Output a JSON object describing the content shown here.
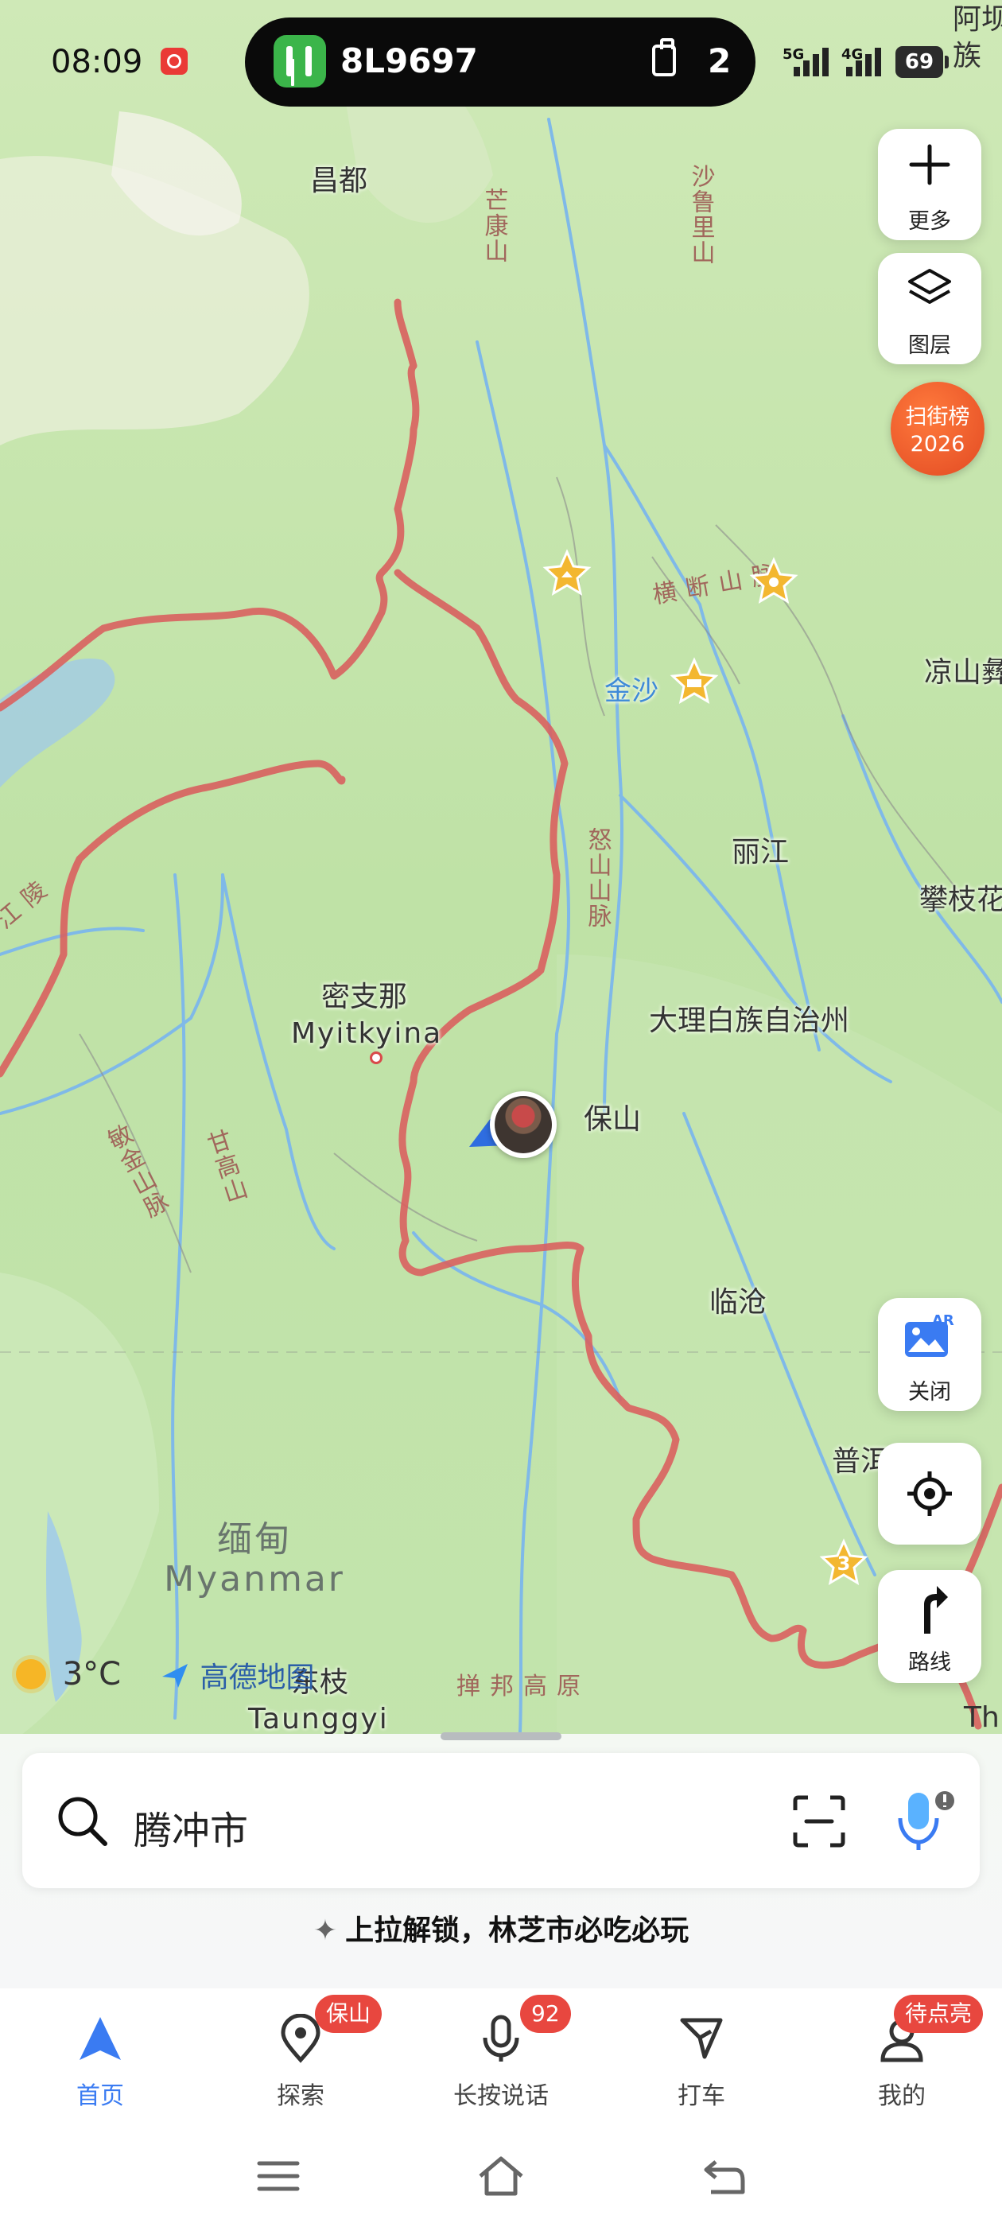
{
  "status_bar": {
    "time": "08:09",
    "flight_code": "8L9697",
    "bag_count": "2",
    "signal_1": "5G",
    "signal_2": "4G",
    "battery": "69",
    "edge_label": "阿坝\n族"
  },
  "map": {
    "labels": {
      "changdu": "昌都",
      "mangkang": "芒康山",
      "shaluli": "沙鲁里山",
      "hengduan": "横断山脉",
      "jinsha": "金沙",
      "liangshan": "凉山彝",
      "lijiang": "丽江",
      "panzhihua": "攀枝花",
      "ganlingjiang": "江陵",
      "nushan": "怒山山脉",
      "myitkyina_cn": "密支那",
      "myitkyina_en": "Myitkyina",
      "dali": "大理白族自治州",
      "baoshan": "保山",
      "minjin": "敏金山脉",
      "ganhao": "甘高山",
      "lincang": "临沧",
      "puer": "普洱",
      "myanmar_cn": "缅甸",
      "myanmar_en": "Myanmar",
      "dongzhi": "东枝",
      "taunggyi": "Taunggyi",
      "shanbang": "掸邦高原",
      "th": "Th",
      "route_shield": "3"
    }
  },
  "right_controls": {
    "more_label": "更多",
    "layers_label": "图层",
    "scan_badge_line1": "扫街榜",
    "scan_badge_line2": "2026",
    "ar_label": "关闭",
    "route_label": "路线"
  },
  "attribution": {
    "temperature": "3°C",
    "logo_text": "高德地图"
  },
  "search": {
    "query": "腾冲市"
  },
  "promo": {
    "text": "上拉解锁，林芝市必吃必玩"
  },
  "tabs": [
    {
      "label": "首页",
      "icon": "navigate-arrow-icon",
      "active": true
    },
    {
      "label": "探索",
      "icon": "location-pin-icon",
      "badge": "保山"
    },
    {
      "label": "长按说话",
      "icon": "microphone-icon",
      "badge": "92"
    },
    {
      "label": "打车",
      "icon": "taxi-flag-icon"
    },
    {
      "label": "我的",
      "icon": "profile-icon",
      "badge": "待点亮"
    }
  ],
  "colors": {
    "accent": "#3a7bf2",
    "border_red": "#d9605f",
    "badge_red": "#e8473f",
    "map_green": "#c6e5b1",
    "river_blue": "#7fb9e8"
  }
}
